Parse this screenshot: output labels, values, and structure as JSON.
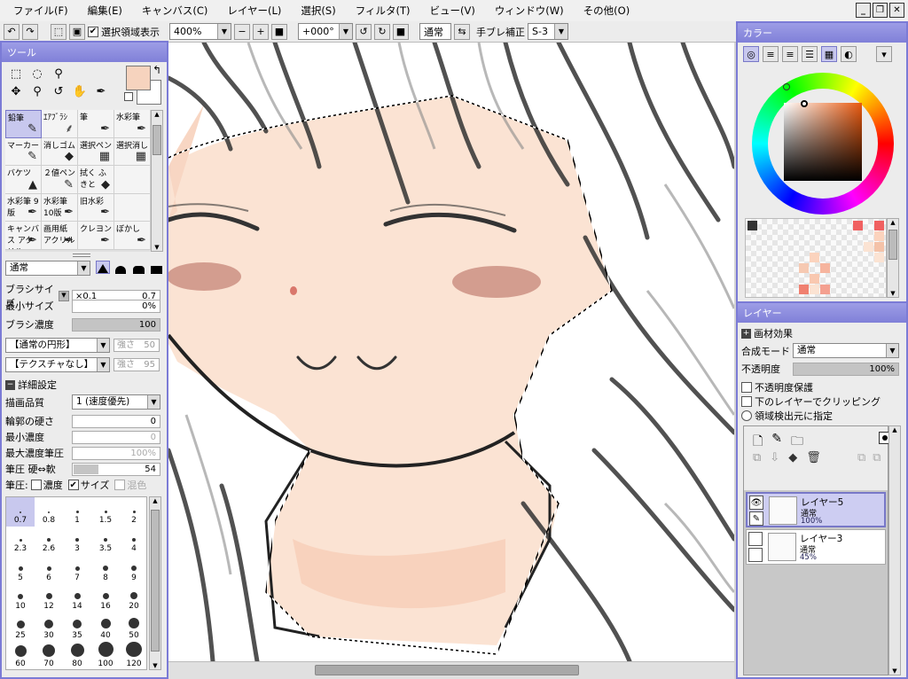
{
  "menu": [
    "ファイル(F)",
    "編集(E)",
    "キャンバス(C)",
    "レイヤー(L)",
    "選択(S)",
    "フィルタ(T)",
    "ビュー(V)",
    "ウィンドウ(W)",
    "その他(O)"
  ],
  "toolbar": {
    "show_selection_label": "選択領域表示",
    "zoom": "400%",
    "rotation": "+000°",
    "blend_mode": "通常",
    "stabilizer_label": "手ブレ補正",
    "stabilizer_value": "S-3"
  },
  "tool_panel": {
    "title": "ツール",
    "brushes": [
      {
        "label": "鉛筆",
        "icon": "✎"
      },
      {
        "label": "ｴｱﾌﾞﾗｼ",
        "icon": "⸙"
      },
      {
        "label": "筆",
        "icon": "✒"
      },
      {
        "label": "水彩筆",
        "icon": "✒"
      },
      {
        "label": "マーカー",
        "icon": "✎"
      },
      {
        "label": "消しゴム",
        "icon": "◆"
      },
      {
        "label": "選択ペン",
        "icon": "▦"
      },
      {
        "label": "選択消し",
        "icon": "▦"
      },
      {
        "label": "バケツ",
        "icon": "▲"
      },
      {
        "label": "２値ペン",
        "icon": "✎"
      },
      {
        "label": "拭く ふきと",
        "icon": "◆"
      },
      {
        "label": "",
        "icon": ""
      },
      {
        "label": "水彩筆 9版",
        "icon": "✒"
      },
      {
        "label": "水彩筆 10版",
        "icon": "✒"
      },
      {
        "label": "旧水彩",
        "icon": "✒"
      },
      {
        "label": "",
        "icon": ""
      },
      {
        "label": "キャンバス アクリル",
        "icon": "✒"
      },
      {
        "label": "画用紙 アクリル",
        "icon": "✒"
      },
      {
        "label": "クレヨン",
        "icon": "✒"
      },
      {
        "label": "ぼかし",
        "icon": "✒"
      }
    ],
    "blend_mode": "通常",
    "brush_size_label": "ブラシサイズ",
    "brush_size_mult": "×0.1",
    "brush_size_value": "0.7",
    "min_size_label": "最小サイズ",
    "min_size_value": "0%",
    "brush_density_label": "ブラシ濃度",
    "brush_density_value": "100",
    "shape_dd": "【通常の円形】",
    "shape_strength_label": "強さ",
    "shape_strength_value": "50",
    "texture_dd": "【テクスチャなし】",
    "texture_strength_label": "強さ",
    "texture_strength_value": "95",
    "advanced_label": "詳細設定",
    "quality_label": "描画品質",
    "quality_value": "1 (速度優先)",
    "edge_hardness_label": "輪郭の硬さ",
    "edge_hardness_value": "0",
    "min_density_label": "最小濃度",
    "min_density_value": "0",
    "max_pressure_label": "最大濃度筆圧",
    "max_pressure_value": "100%",
    "pressure_hard_soft_label": "筆圧 硬⇔軟",
    "pressure_hard_soft_value": "54",
    "pressure_label": "筆圧:",
    "pressure_density": "濃度",
    "pressure_size": "サイズ",
    "pressure_blend": "混色",
    "sizes": [
      "0.7",
      "0.8",
      "1",
      "1.5",
      "2",
      "2.3",
      "2.6",
      "3",
      "3.5",
      "4",
      "5",
      "6",
      "7",
      "8",
      "9",
      "10",
      "12",
      "14",
      "16",
      "20",
      "25",
      "30",
      "35",
      "40",
      "50",
      "60",
      "70",
      "80",
      "100",
      "120"
    ]
  },
  "color_panel": {
    "title": "カラー"
  },
  "layer_panel": {
    "title": "レイヤー",
    "effects_label": "画材効果",
    "composite_label": "合成モード",
    "composite_value": "通常",
    "opacity_label": "不透明度",
    "opacity_value": "100%",
    "protect_opacity": "不透明度保護",
    "clip_below": "下のレイヤーでクリッピング",
    "area_source": "領域検出元に指定",
    "layers": [
      {
        "name": "レイヤー5",
        "mode": "通常",
        "opacity": "100%"
      },
      {
        "name": "レイヤー3",
        "mode": "通常",
        "opacity": "45%"
      }
    ]
  },
  "colors": {
    "accent": "#7b7bd6",
    "fg": "#f6d3be",
    "bg": "#ffffff"
  }
}
